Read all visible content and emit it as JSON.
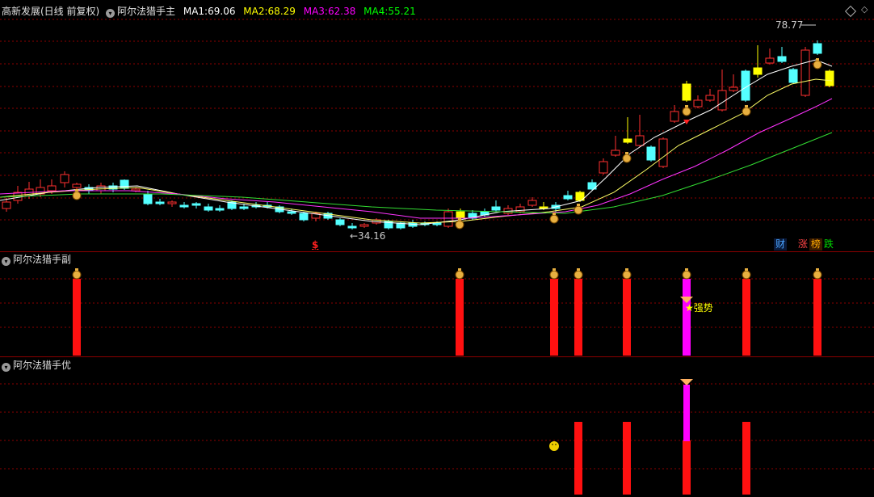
{
  "header": {
    "stock_name": "高新发展(日线 前复权)",
    "main_indicator": "阿尔法猎手主",
    "ma": [
      {
        "label": "MA1:",
        "value": "69.06",
        "color": "#ffffff"
      },
      {
        "label": "MA2:",
        "value": "68.29",
        "color": "#ffff00"
      },
      {
        "label": "MA3:",
        "value": "62.38",
        "color": "#ff00ff"
      },
      {
        "label": "MA4:",
        "value": "55.21",
        "color": "#00ff00"
      }
    ]
  },
  "main_chart": {
    "high_label": "78.77",
    "low_label": "←34.16",
    "marker_s": "$",
    "badges": [
      {
        "text": "财",
        "color": "#4aa3ff"
      },
      {
        "text": "涨",
        "color": "#ff4444"
      },
      {
        "text": "榜",
        "color": "#ffaa00"
      },
      {
        "text": "跌",
        "color": "#00dd00"
      }
    ]
  },
  "sub_panel": {
    "title": "阿尔法猎手副",
    "signal_label": "★强势"
  },
  "opt_panel": {
    "title": "阿尔法猎手优"
  },
  "colors": {
    "up": "#ff3030",
    "down": "#54ffff",
    "signal": "#ffff00",
    "strong": "#ff00ff"
  }
}
